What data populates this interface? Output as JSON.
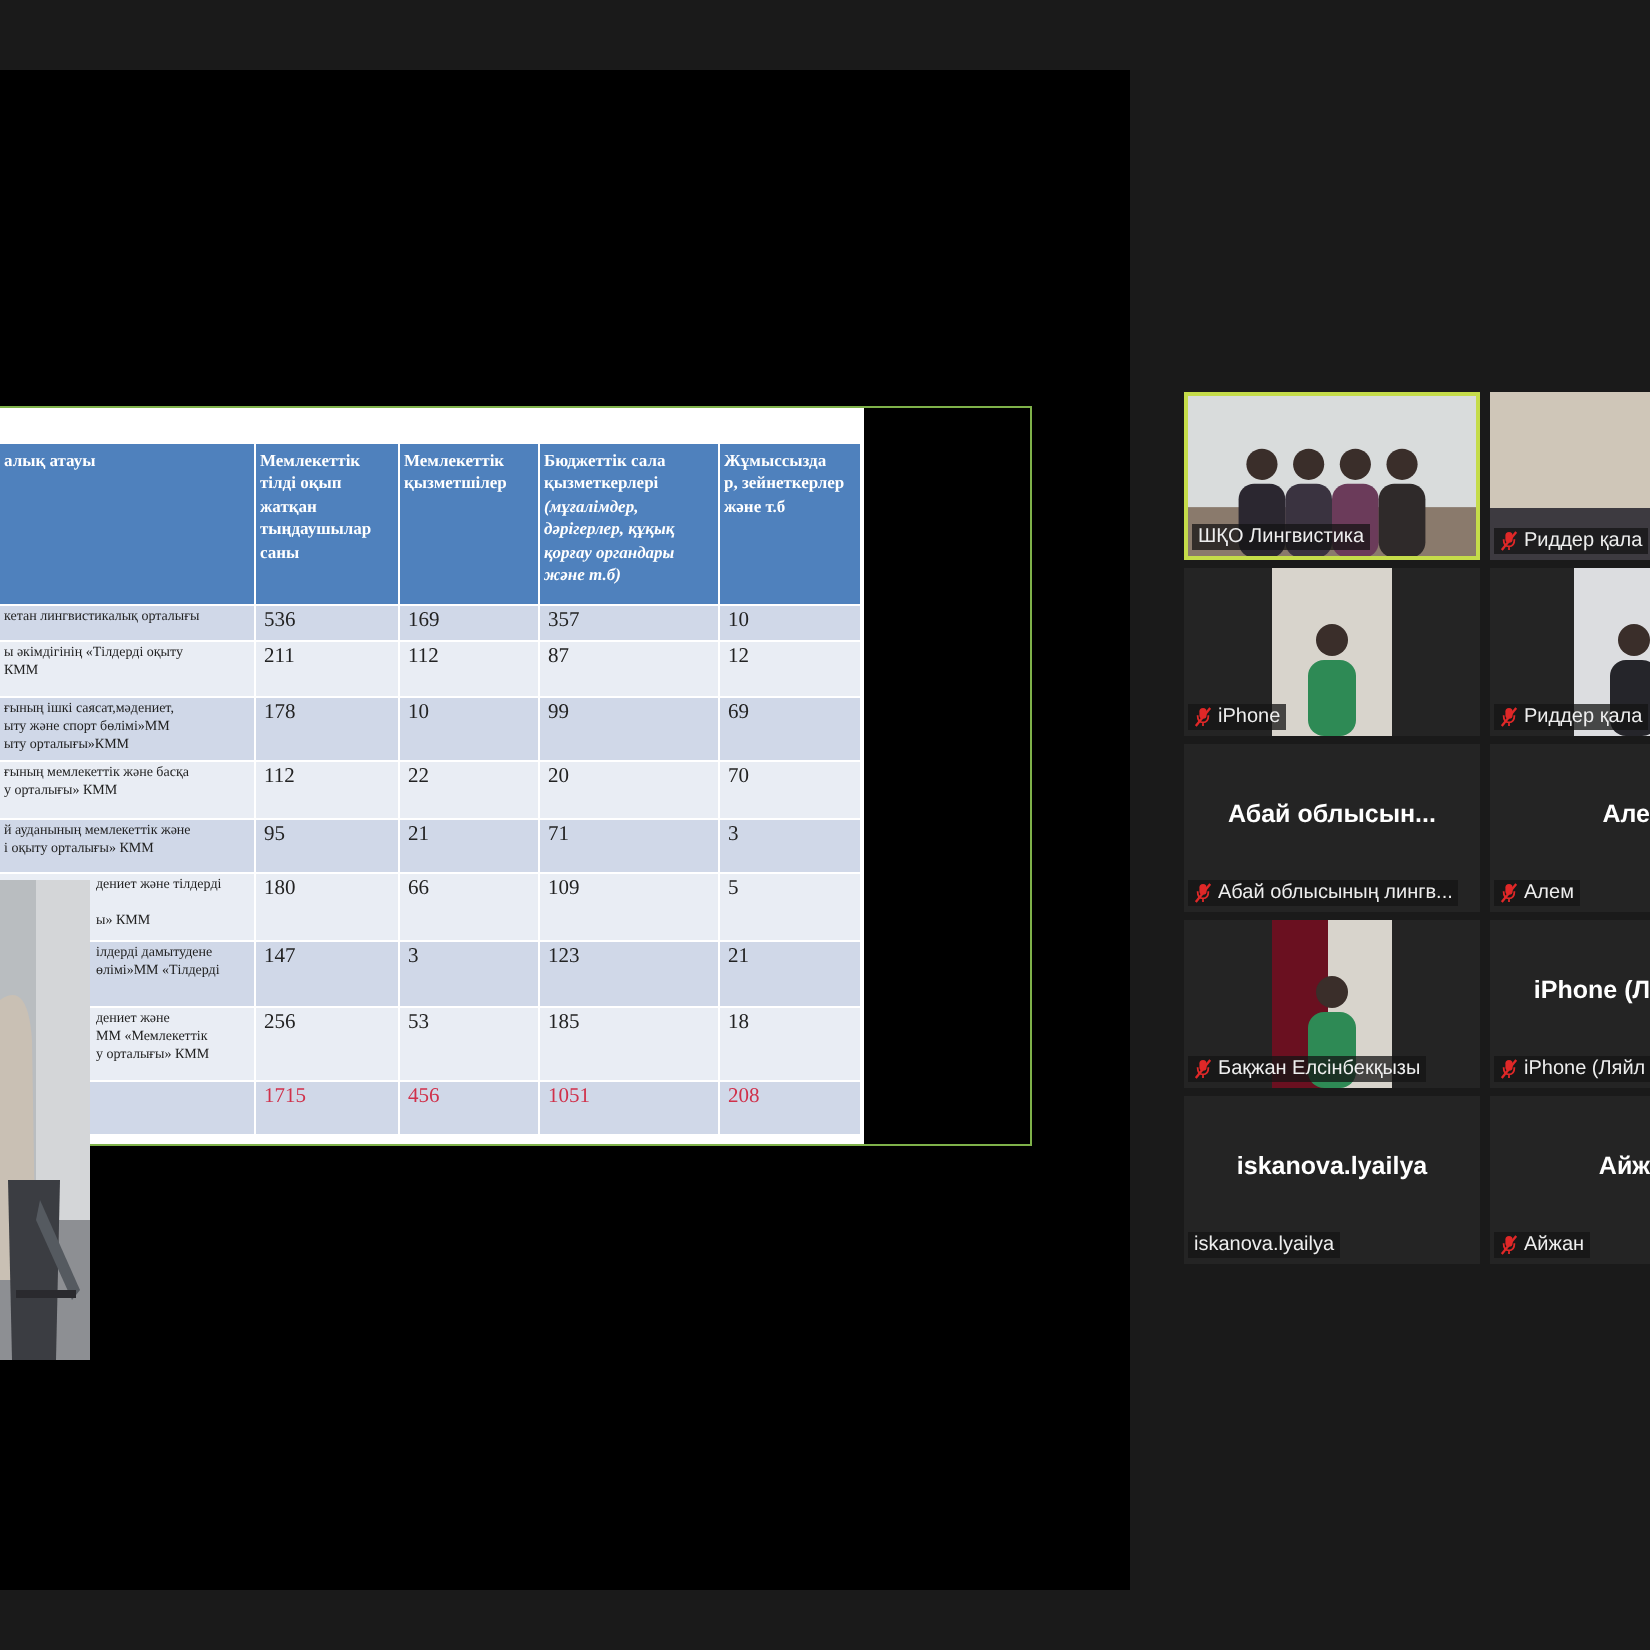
{
  "shared_slide": {
    "table": {
      "columns": [
        "алық атауы",
        "Мемлекеттік тілді оқып жатқан тыңдаушылар саны",
        "Мемлекеттік қызметшілер",
        "Бюджеттік сала қызметкерлері *(мұғалімдер, дәрігерлер, құқық қорғау органдары және т.б)*",
        "Жұмыссызда\nр, зейнеткерлер және т.б"
      ],
      "rows": [
        {
          "kind": "data",
          "under_camera": false,
          "name": "кетан лингвистикалық орталығы",
          "values": [
            "536",
            "169",
            "357",
            "10"
          ]
        },
        {
          "kind": "data",
          "under_camera": false,
          "name": "ы әкімдігінің «Тілдерді оқыту\nКММ",
          "values": [
            "211",
            "112",
            "87",
            "12"
          ]
        },
        {
          "kind": "data",
          "under_camera": false,
          "name": "ғының ішкі саясат,мәдениет,\nыту және спорт бөлімі»ММ\nыту орталығы»КММ",
          "values": [
            "178",
            "10",
            "99",
            "69"
          ]
        },
        {
          "kind": "data",
          "under_camera": false,
          "name": "ғының мемлекеттік және басқа\nу орталығы» КММ",
          "values": [
            "112",
            "22",
            "20",
            "70"
          ]
        },
        {
          "kind": "data",
          "under_camera": false,
          "name": "й ауданының мемлекеттік және\nі оқыту орталығы» КММ",
          "values": [
            "95",
            "21",
            "71",
            "3"
          ]
        },
        {
          "kind": "data",
          "under_camera": true,
          "name": "дениет және тілдерді\n\nы» КММ",
          "values": [
            "180",
            "66",
            "109",
            "5"
          ]
        },
        {
          "kind": "data",
          "under_camera": true,
          "name": "ілдерді дамытудене\nөлімі»ММ «Тілдерді",
          "values": [
            "147",
            "3",
            "123",
            "21"
          ]
        },
        {
          "kind": "data",
          "under_camera": true,
          "name": "дениет және\nММ «Мемлекеттік\nу орталығы» КММ",
          "values": [
            "256",
            "53",
            "185",
            "18"
          ]
        },
        {
          "kind": "total",
          "under_camera": false,
          "values": [
            "1715",
            "456",
            "1051",
            "208"
          ]
        }
      ]
    }
  },
  "participants": [
    {
      "kind": "video",
      "active": true,
      "muted": false,
      "name_label": "ШҚО Лингвистика"
    },
    {
      "kind": "video",
      "active": false,
      "muted": true,
      "name_label": "Риддер қала"
    },
    {
      "kind": "video",
      "active": false,
      "muted": true,
      "name_label": "iPhone"
    },
    {
      "kind": "video",
      "active": false,
      "muted": true,
      "name_label": "Риддер қала"
    },
    {
      "kind": "name",
      "active": false,
      "muted": true,
      "display_name": "Абай  облысын...",
      "name_label": "Абай облысының лингв..."
    },
    {
      "kind": "name",
      "active": false,
      "muted": true,
      "display_name": "Але",
      "name_label": "Алем"
    },
    {
      "kind": "video",
      "active": false,
      "muted": true,
      "name_label": "Бақжан Елсінбекқызы"
    },
    {
      "kind": "name",
      "active": false,
      "muted": true,
      "display_name": "iPhone (Л",
      "name_label": "iPhone (Ляйл"
    },
    {
      "kind": "name",
      "active": false,
      "muted": false,
      "display_name": "iskanova.lyailya",
      "name_label": "iskanova.lyailya"
    },
    {
      "kind": "name",
      "active": false,
      "muted": true,
      "display_name": "Айж",
      "name_label": "Айжан"
    }
  ]
}
